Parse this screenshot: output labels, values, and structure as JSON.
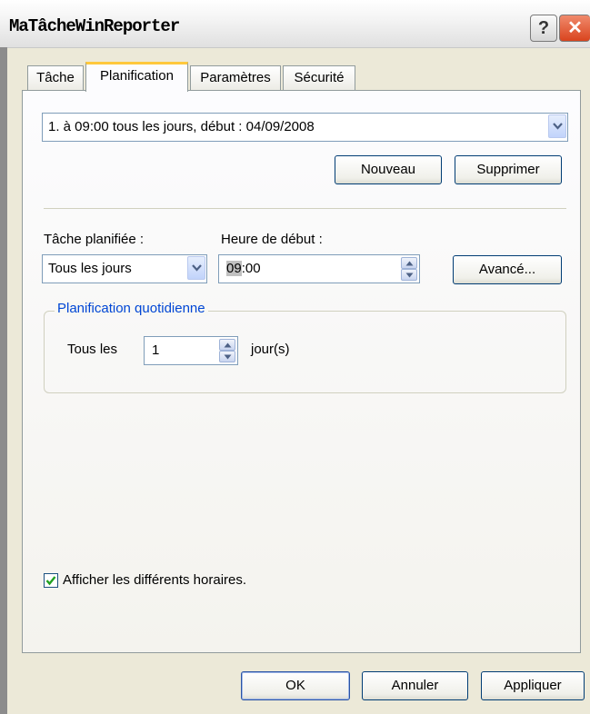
{
  "window": {
    "title": "MaTâcheWinReporter",
    "help_label": "?",
    "close_label": "✕"
  },
  "tabs": [
    {
      "label": "Tâche",
      "active": false
    },
    {
      "label": "Planification",
      "active": true
    },
    {
      "label": "Paramètres",
      "active": false
    },
    {
      "label": "Sécurité",
      "active": false
    }
  ],
  "schedule": {
    "selected": "1. à 09:00 tous les jours, début : 04/09/2008",
    "new_label": "Nouveau",
    "delete_label": "Supprimer"
  },
  "task": {
    "scheduled_label": "Tâche planifiée :",
    "scheduled_value": "Tous les jours",
    "start_label": "Heure de début :",
    "start_hour": "09",
    "start_rest": ":00",
    "advanced_label": "Avancé..."
  },
  "daily": {
    "group_label": "Planification quotidienne",
    "every_label": "Tous les",
    "every_value": "1",
    "unit_label": "jour(s)"
  },
  "options": {
    "show_multiple_label": "Afficher les différents horaires.",
    "show_multiple_checked": true
  },
  "footer": {
    "ok_label": "OK",
    "cancel_label": "Annuler",
    "apply_label": "Appliquer"
  },
  "colors": {
    "accent_tab": "#ffc83c",
    "group_label": "#0046d5",
    "close_button": "#d9441e"
  }
}
